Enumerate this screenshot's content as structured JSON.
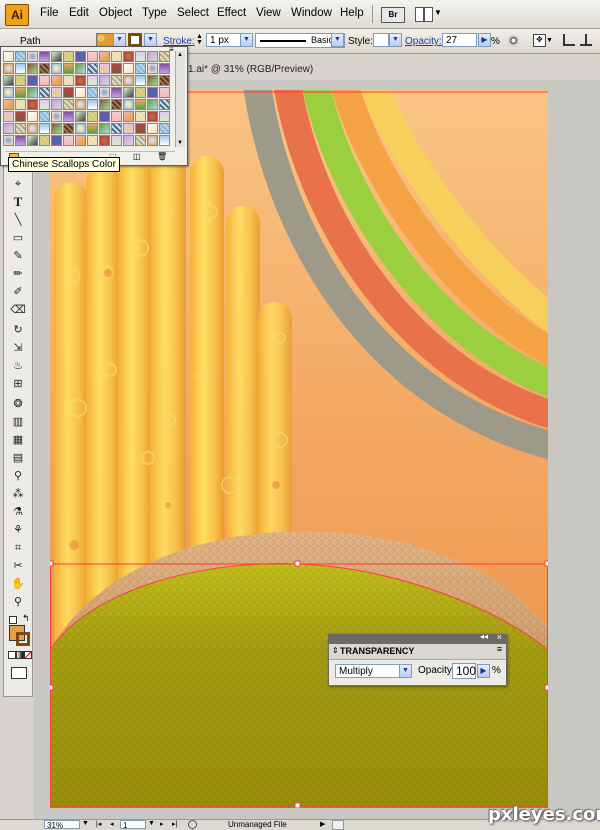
{
  "app": {
    "logo_text": "Ai",
    "accent": "#f0a21a"
  },
  "menu": [
    "File",
    "Edit",
    "Object",
    "Type",
    "Select",
    "Effect",
    "View",
    "Window",
    "Help"
  ],
  "control_bar": {
    "selection_type": "Path",
    "stroke_label": "Stroke:",
    "stroke_value": "1 px",
    "brush_label": "Basic",
    "style_label": "Style:",
    "opacity_label": "Opacity:",
    "opacity_value": "27",
    "percent": "%"
  },
  "document": {
    "title": "1.ai* @ 31% (RGB/Preview)"
  },
  "swatch_panel": {
    "tooltip": "Chinese Scallops Color"
  },
  "transparency_panel": {
    "title": "TRANSPARENCY",
    "blend_mode": "Multiply",
    "opacity_label": "Opacity:",
    "opacity_value": "100",
    "percent": "%"
  },
  "status_bar": {
    "zoom": "31%",
    "artboard": "1",
    "status_text": "Unmanaged File"
  },
  "watermark": "pxleyes.com",
  "colors": {
    "background_orange": "#f0a155",
    "rainbow": [
      "#9e9a8a",
      "#e8734a",
      "#9ccf3e",
      "#f5a245",
      "#f6d05a"
    ],
    "hill_tan": "#d9a877",
    "hill_olive": "#a39b10",
    "selection_red": "#ff3b3b"
  }
}
